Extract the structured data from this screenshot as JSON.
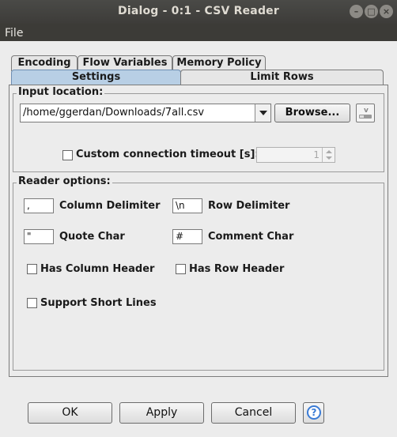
{
  "window": {
    "title": "Dialog - 0:1 - CSV Reader",
    "controls": [
      "minimize",
      "maximize",
      "close"
    ]
  },
  "menu": {
    "file": "File"
  },
  "tabs": {
    "encoding": "Encoding",
    "flow_variables": "Flow Variables",
    "memory_policy": "Memory Policy",
    "settings": "Settings",
    "limit_rows": "Limit Rows",
    "active": "Settings"
  },
  "input_location": {
    "title": "Input location:",
    "path": "/home/ggerdan/Downloads/7all.csv",
    "browse_label": "Browse...",
    "timeout_label": "Custom connection timeout [s]:",
    "timeout_checked": false,
    "timeout_value": "1"
  },
  "reader_options": {
    "title": "Reader options:",
    "column_delimiter": {
      "value": ",",
      "label": "Column Delimiter"
    },
    "row_delimiter": {
      "value": "\\n",
      "label": "Row Delimiter"
    },
    "quote_char": {
      "value": "\"",
      "label": "Quote Char"
    },
    "comment_char": {
      "value": "#",
      "label": "Comment Char"
    },
    "has_column_header": {
      "label": "Has Column Header",
      "checked": false
    },
    "has_row_header": {
      "label": "Has Row Header",
      "checked": false
    },
    "support_short_lines": {
      "label": "Support Short Lines",
      "checked": false
    }
  },
  "buttons": {
    "ok": "OK",
    "apply": "Apply",
    "cancel": "Cancel",
    "help": "?"
  },
  "colors": {
    "selected_tab": "#b8cfe5",
    "titlebar": "#3d3c39",
    "help_icon": "#3a7bd5"
  }
}
